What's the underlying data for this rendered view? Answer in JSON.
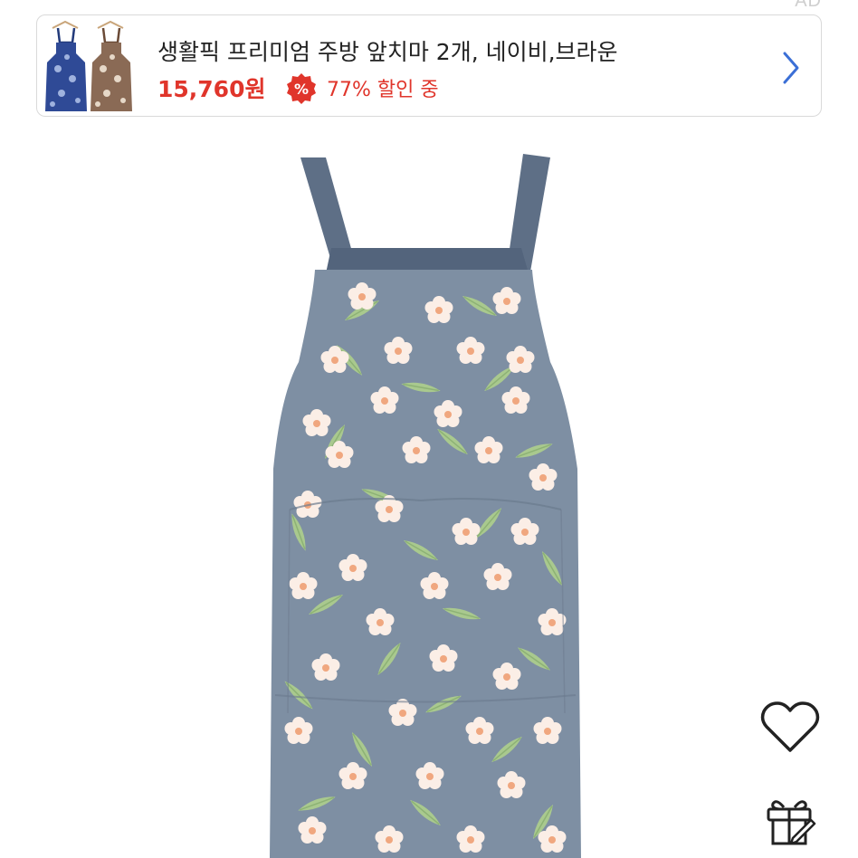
{
  "ad": {
    "badge_text": "AD",
    "title": "생활픽 프리미엄 주방 앞치마 2개, 네이비,브라운",
    "price": "15,760원",
    "discount_badge_symbol": "%",
    "discount_text": "77% 할인 중",
    "accent_color": "#e0352b",
    "thumbnail_icon": "apron-pair-thumbnail",
    "chevron_icon": "chevron-right-icon"
  },
  "product": {
    "image_icon": "floral-apron-image",
    "colors": {
      "fabric": "#7e8fa3",
      "strap": "#5e6f86"
    }
  },
  "actions": {
    "like_icon": "heart-icon",
    "gift_icon": "gift-icon"
  }
}
